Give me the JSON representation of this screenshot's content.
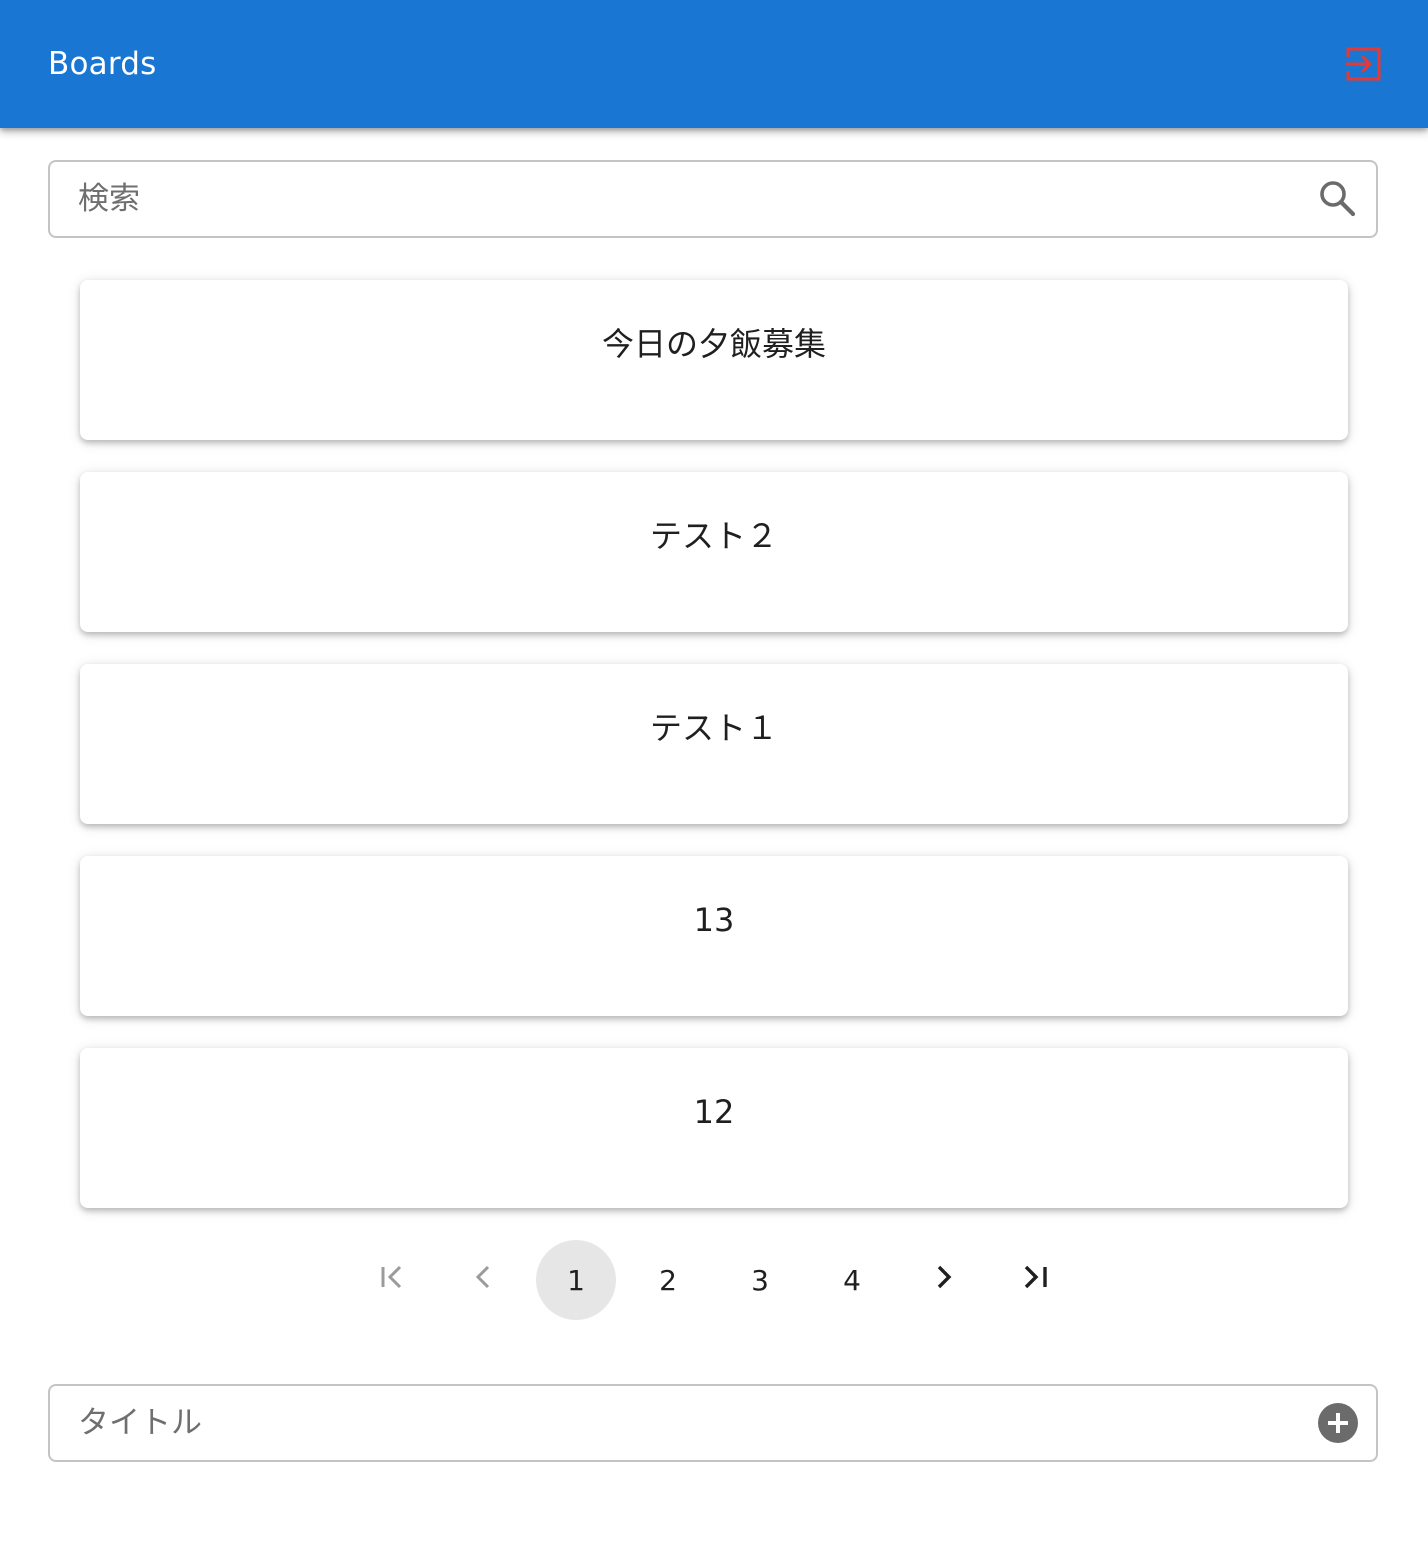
{
  "appbar": {
    "title": "Boards",
    "logout_icon": "logout-icon",
    "logout_color": "#e53935",
    "background": "#1976d2"
  },
  "search": {
    "placeholder": "検索",
    "value": "",
    "icon": "search-icon"
  },
  "boards": [
    {
      "title": "今日の夕飯募集"
    },
    {
      "title": "テスト２"
    },
    {
      "title": "テスト１"
    },
    {
      "title": "13"
    },
    {
      "title": "12"
    }
  ],
  "pagination": {
    "first_icon": "first-page-icon",
    "prev_icon": "chevron-left-icon",
    "pages": [
      "1",
      "2",
      "3",
      "4"
    ],
    "current_page": "1",
    "next_icon": "chevron-right-icon",
    "last_icon": "last-page-icon"
  },
  "new_board": {
    "placeholder": "タイトル",
    "value": "",
    "icon": "add-circle-icon"
  }
}
